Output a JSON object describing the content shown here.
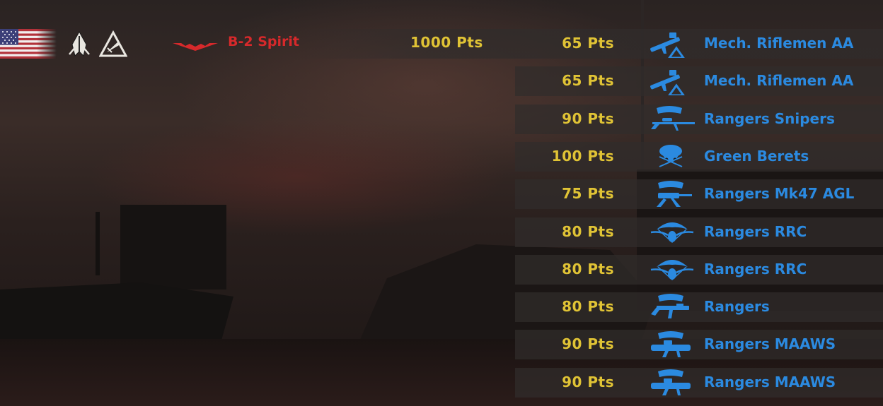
{
  "colors": {
    "points": "#e0c335",
    "unit_name": "#2b8ae0",
    "air_unit": "#d7292b"
  },
  "nation": {
    "flag_icon": "usa-flag-icon"
  },
  "specializations": [
    "special-forces-spearhead-icon",
    "airborne-triangle-icon"
  ],
  "air_unit": {
    "icon": "stealth-bomber-icon",
    "name": "B-2 Spirit",
    "points": "1000 Pts"
  },
  "units": [
    {
      "points": "65 Pts",
      "name": "Mech. Riflemen AA",
      "icon": "aa-launcher-icon"
    },
    {
      "points": "65 Pts",
      "name": "Mech. Riflemen AA",
      "icon": "aa-launcher-icon"
    },
    {
      "points": "90 Pts",
      "name": "Rangers Snipers",
      "icon": "ranger-sniper-icon"
    },
    {
      "points": "100 Pts",
      "name": "Green Berets",
      "icon": "green-beret-icon"
    },
    {
      "points": "75 Pts",
      "name": "Rangers Mk47 AGL",
      "icon": "ranger-grenade-launcher-icon"
    },
    {
      "points": "80 Pts",
      "name": "Rangers RRC",
      "icon": "parachute-wings-icon"
    },
    {
      "points": "80 Pts",
      "name": "Rangers RRC",
      "icon": "parachute-wings-icon"
    },
    {
      "points": "80 Pts",
      "name": "Rangers",
      "icon": "ranger-rifle-icon"
    },
    {
      "points": "90 Pts",
      "name": "Rangers MAAWS",
      "icon": "ranger-recoilless-rifle-icon"
    },
    {
      "points": "90 Pts",
      "name": "Rangers MAAWS",
      "icon": "ranger-recoilless-rifle-icon"
    }
  ]
}
